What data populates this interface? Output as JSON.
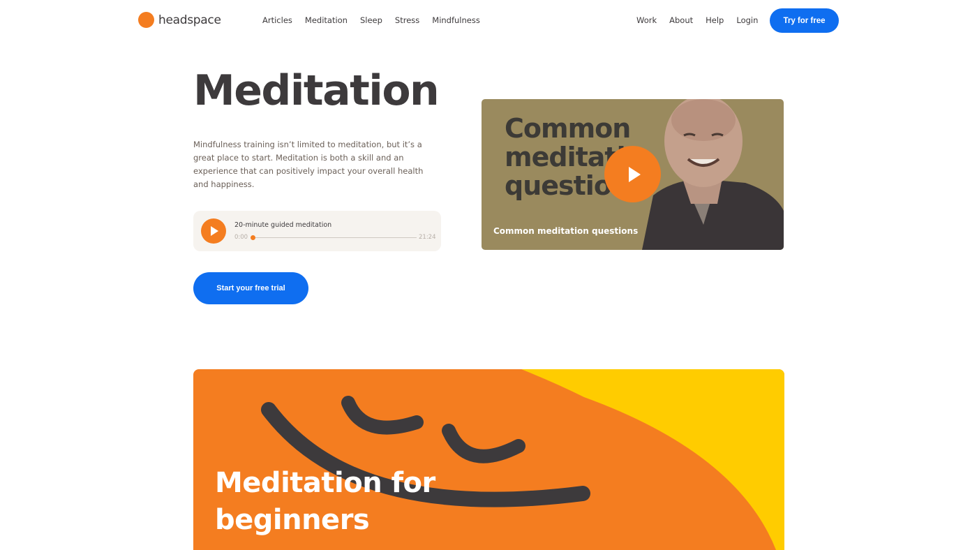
{
  "header": {
    "brand": "headspace",
    "nav_left": [
      "Articles",
      "Meditation",
      "Sleep",
      "Stress",
      "Mindfulness"
    ],
    "nav_right": [
      "Work",
      "About",
      "Help",
      "Login"
    ],
    "cta_label": "Try for free"
  },
  "hero": {
    "title": "Meditation",
    "description": "Mindfulness training isn’t limited to meditation, but it’s a great place to start. Meditation is both a skill and an experience that can positively impact your overall health and happiness.",
    "player": {
      "title": "20-minute guided meditation",
      "current_time": "0:00",
      "duration": "21:24",
      "progress": 0
    },
    "trial_button": "Start your free trial"
  },
  "video": {
    "thumbnail_text": "Common\nmeditati\nquestio",
    "caption": "Common meditation questions"
  },
  "banner": {
    "title": "Meditation for\nbeginners"
  },
  "colors": {
    "brand_orange": "#f47d20",
    "cta_blue": "#0f6ef0",
    "banner_yellow": "#ffcc00",
    "text_dark": "#3d3a3c"
  }
}
